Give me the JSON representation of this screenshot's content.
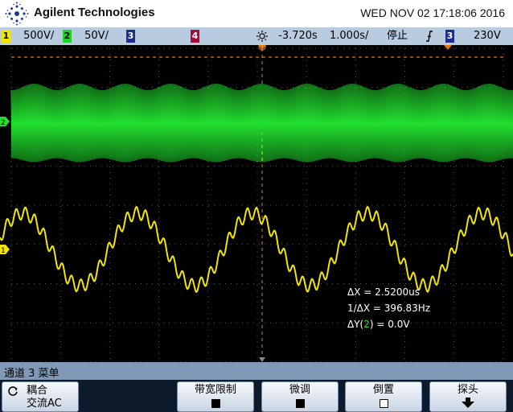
{
  "title_bar": {
    "brand": "Agilent Technologies",
    "datetime": "WED NOV 02 17:18:06 2016"
  },
  "status_bar": {
    "ch1": {
      "number": "1",
      "scale": "500V/"
    },
    "ch2": {
      "number": "2",
      "scale": "50V/"
    },
    "ch3": {
      "number": "3"
    },
    "ch4": {
      "number": "4"
    },
    "delay": "-3.720s",
    "timebase": "1.000s/",
    "run_state": "停止",
    "trigger_source": "3",
    "trigger_level": "230V",
    "trigger_icon": "trigger-edge-icon"
  },
  "graticule": {
    "markers": {
      "ch1": "1",
      "ch2": "2"
    },
    "cursor_readout": {
      "dx_label": "ΔX = ",
      "dx_value": "2.5200us",
      "inv_dx_label": "1/ΔX = ",
      "inv_dx_value": "396.83Hz",
      "dy_prefix": "ΔY(",
      "dy_channel": "2",
      "dy_suffix": ") = 0.0V"
    }
  },
  "menu": {
    "title": "通道 3 菜单",
    "softkeys": {
      "coupling_label": "耦合",
      "coupling_value": "交流AC",
      "bw_limit_label": "带宽限制",
      "fine_label": "微调",
      "invert_label": "倒置",
      "probe_label": "探头"
    }
  },
  "colors": {
    "ch1": "#f2e600",
    "ch2": "#22d32e",
    "ch3": "#1a2e8a",
    "ch4": "#a50e38",
    "status_bar": "#b9cbde",
    "menu_bar": "#7f99b6"
  }
}
